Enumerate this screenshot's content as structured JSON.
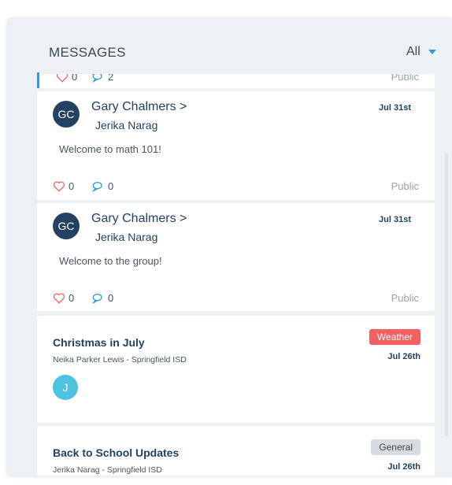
{
  "header": {
    "title": "MESSAGES",
    "filter_label": "All"
  },
  "partial_card": {
    "likes": "0",
    "comments": "2",
    "visibility": "Public"
  },
  "messages": [
    {
      "initials": "GC",
      "from": "Gary Chalmers >",
      "to": "Jerika Narag",
      "date": "Jul 31st",
      "body": "Welcome to math 101!",
      "likes": "0",
      "comments": "0",
      "visibility": "Public"
    },
    {
      "initials": "GC",
      "from": "Gary Chalmers >",
      "to": "Jerika Narag",
      "date": "Jul 31st",
      "body": "Welcome to the group!",
      "likes": "0",
      "comments": "0",
      "visibility": "Public"
    }
  ],
  "posts": [
    {
      "title": "Christmas in July",
      "subtitle": "Neika Parker Lewis - Springfield ISD",
      "tag": "Weather",
      "date": "Jul 26th",
      "avatar_initial": "J"
    },
    {
      "title": "Back to School Updates",
      "subtitle": "Jerika Narag - Springfield ISD",
      "tag": "General",
      "date": "Jul 26th"
    }
  ],
  "colors": {
    "accent": "#2f9ae0",
    "navy": "#234261",
    "weather_tag": "#f26060",
    "general_tag": "#d9dcdf",
    "heart": "#f26060"
  }
}
